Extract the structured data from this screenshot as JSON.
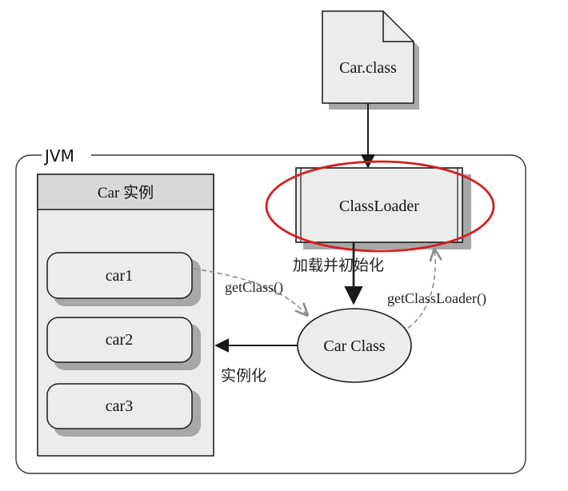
{
  "file": {
    "label": "Car.class"
  },
  "jvm": {
    "label": "JVM"
  },
  "classloader": {
    "label": "ClassLoader"
  },
  "load_edge": {
    "label": "加载并初始化"
  },
  "get_classloader_edge": {
    "label": "getClassLoader()"
  },
  "get_class_edge": {
    "label": "getClass()"
  },
  "car_class": {
    "label": "Car Class"
  },
  "instantiate_edge": {
    "label": "实例化"
  },
  "instances": {
    "title": "Car 实例",
    "items": [
      {
        "label": "car1"
      },
      {
        "label": "car2"
      },
      {
        "label": "car3"
      }
    ]
  },
  "colors": {
    "highlight_ring": "#d42020",
    "box_fill": "#ececec",
    "header_fill": "#d8d8d8",
    "shadow": "#a8a8a8",
    "stroke": "#1a1a1a",
    "dashed": "#8a8a8a"
  }
}
